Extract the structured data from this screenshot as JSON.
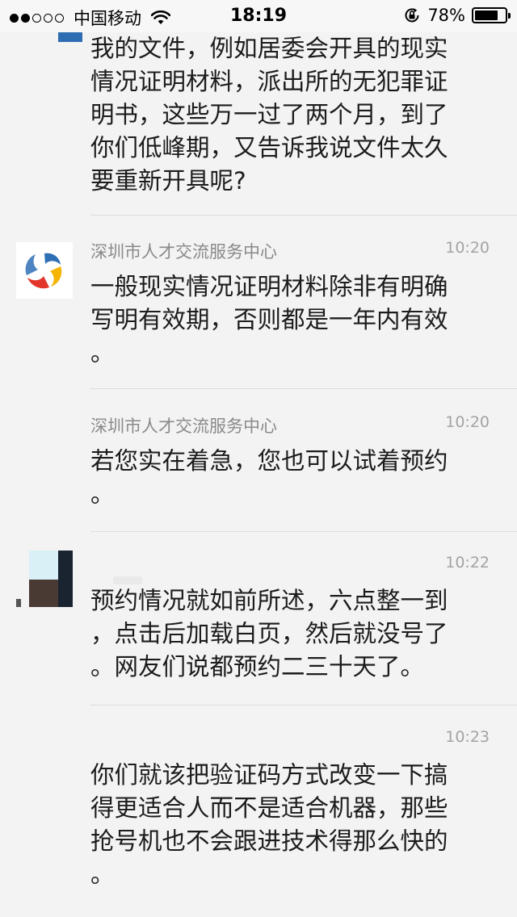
{
  "status_bar": {
    "carrier": "中国移动",
    "time": "18:19",
    "battery_percent": "78%",
    "battery_level": 0.78,
    "signal_filled": 2,
    "signal_total": 5
  },
  "messages": [
    {
      "sender": "",
      "time": "",
      "text": "我的文件，例如居委会开具的现实\n情况证明材料，派出所的无犯罪证\n明书，这些万一过了两个月，到了\n你们低峰期，又告诉我说文件太久\n要重新开具呢?"
    },
    {
      "sender": "深圳市人才交流服务中心",
      "time": "10:20",
      "text": "一般现实情况证明材料除非有明确\n写明有效期，否则都是一年内有效\n。"
    },
    {
      "sender": "深圳市人才交流服务中心",
      "time": "10:20",
      "text": "若您实在着急，您也可以试着预约\n。"
    },
    {
      "sender": "",
      "time": "10:22",
      "text": "预约情况就如前所述，六点整一到\n，点击后加载白页，然后就没号了\n。网友们说都预约二三十天了。"
    },
    {
      "sender": "",
      "time": "10:23",
      "text": "你们就该把验证码方式改变一下搞\n得更适合人而不是适合机器，那些\n抢号机也不会跟进技术得那么快的\n。"
    }
  ],
  "colors": {
    "background": "#f3f3f3",
    "text": "#1c1c1c",
    "meta": "#a3a3a3",
    "logo_red": "#e2352b",
    "logo_blue": "#2e6fb6",
    "logo_yellow": "#f4b400"
  },
  "icons": {
    "wifi": "wifi-icon",
    "orientation_lock": "orientation-lock-icon",
    "battery": "battery-icon",
    "org_logo": "service-center-logo-icon"
  }
}
